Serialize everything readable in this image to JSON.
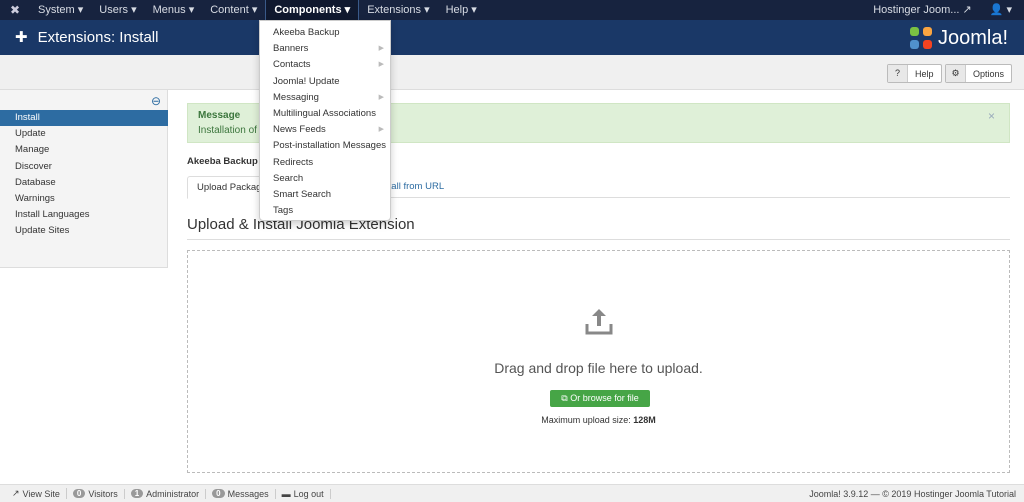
{
  "topnav": {
    "menus": [
      "System",
      "Users",
      "Menus",
      "Content",
      "Components",
      "Extensions",
      "Help"
    ],
    "active": "Components",
    "site_name": "Hostinger Joom..."
  },
  "header": {
    "title": "Extensions: Install",
    "brand": "Joomla!"
  },
  "toolbar": {
    "help": "Help",
    "options": "Options"
  },
  "sidebar": {
    "items": [
      "Install",
      "Update",
      "Manage",
      "Discover",
      "Database",
      "Warnings",
      "Install Languages",
      "Update Sites"
    ],
    "active": "Install"
  },
  "message": {
    "heading": "Message",
    "text": "Installation of th"
  },
  "akeeba_text": "Akeeba Backup i",
  "tabs": [
    "Upload Package",
    "Install from URL"
  ],
  "section_title": "Upload & Install Joomla Extension",
  "upload": {
    "drag_text": "Drag and drop file here to upload.",
    "browse": "Or browse for file",
    "max_label": "Maximum upload size:",
    "max_value": "128M"
  },
  "footer": {
    "view_site": "View Site",
    "visitors_count": "0",
    "visitors": "Visitors",
    "admin_count": "1",
    "admin": "Administrator",
    "messages_count": "0",
    "messages": "Messages",
    "logout": "Log out",
    "copyright": "Joomla! 3.9.12 — © 2019 Hostinger Joomla Tutorial"
  },
  "dropdown": {
    "items": [
      {
        "label": "Akeeba Backup",
        "sub": false
      },
      {
        "label": "Banners",
        "sub": true
      },
      {
        "label": "Contacts",
        "sub": true
      },
      {
        "label": "Joomla! Update",
        "sub": false
      },
      {
        "label": "Messaging",
        "sub": true
      },
      {
        "label": "Multilingual Associations",
        "sub": false
      },
      {
        "label": "News Feeds",
        "sub": true
      },
      {
        "label": "Post-installation Messages",
        "sub": false
      },
      {
        "label": "Redirects",
        "sub": false
      },
      {
        "label": "Search",
        "sub": false
      },
      {
        "label": "Smart Search",
        "sub": false
      },
      {
        "label": "Tags",
        "sub": false
      }
    ]
  },
  "colors": {
    "topnav": "#17233f",
    "header": "#1a3867",
    "active": "#2d6ca2",
    "success": "#46a546",
    "message_bg": "#dff0d8"
  }
}
